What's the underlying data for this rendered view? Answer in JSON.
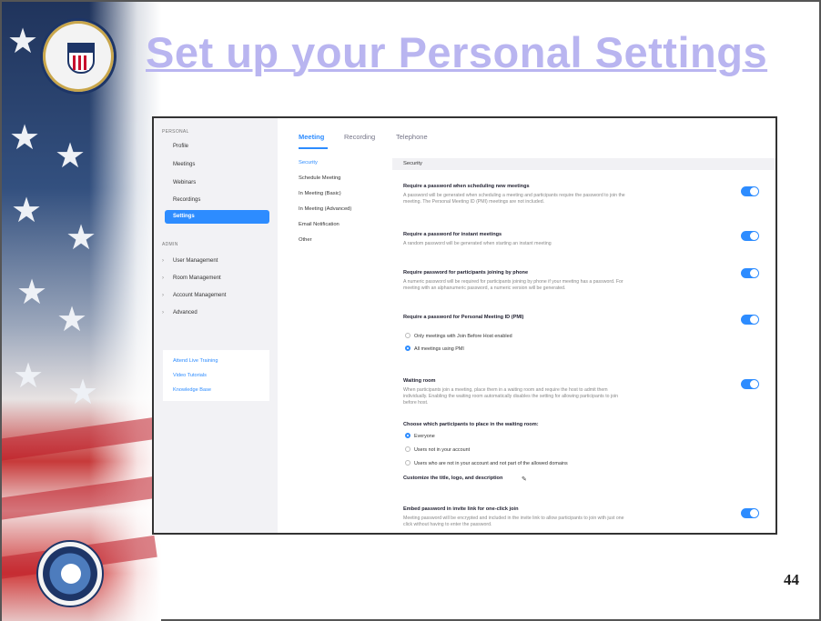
{
  "slide": {
    "title": "Set up your Personal Settings",
    "page_number": "44"
  },
  "sidebar": {
    "personal_heading": "PERSONAL",
    "personal_items": [
      "Profile",
      "Meetings",
      "Webinars",
      "Recordings",
      "Settings"
    ],
    "active_item": "Settings",
    "admin_heading": "ADMIN",
    "admin_items": [
      "User Management",
      "Room Management",
      "Account Management",
      "Advanced"
    ],
    "help_links": [
      "Attend Live Training",
      "Video Tutorials",
      "Knowledge Base"
    ]
  },
  "tabs": [
    "Meeting",
    "Recording",
    "Telephone"
  ],
  "active_tab": "Meeting",
  "subnav": [
    "Security",
    "Schedule Meeting",
    "In Meeting (Basic)",
    "In Meeting (Advanced)",
    "Email Notification",
    "Other"
  ],
  "active_subnav": "Security",
  "section_title": "Security",
  "settings": [
    {
      "title": "Require a password when scheduling new meetings",
      "desc1": "A password will be generated when scheduling a meeting and participants require the password to join the",
      "desc2": "meeting. The Personal Meeting ID (PMI) meetings are not included.",
      "enabled": true
    },
    {
      "title": "Require a password for instant meetings",
      "desc1": "A random password will be generated when starting an instant meeting",
      "enabled": true
    },
    {
      "title": "Require password for participants joining by phone",
      "desc1": "A numeric password will be required for participants joining by phone if your meeting has a password. For",
      "desc2": "meeting with an alphanumeric password, a numeric version will be generated.",
      "enabled": true
    },
    {
      "title": "Require a password for Personal Meeting ID (PMI)",
      "enabled": true,
      "options": [
        "Only meetings with Join Before Host enabled",
        "All meetings using PMI"
      ],
      "selected_option": "All meetings using PMI"
    },
    {
      "title": "Waiting room",
      "desc1": "When participants join a meeting, place them in a waiting room and require the host to admit them",
      "desc2": "individually. Enabling the waiting room automatically disables the setting for allowing participants to join",
      "desc3": "before host.",
      "enabled": true
    },
    {
      "title": "Embed password in invite link for one-click join",
      "desc1": "Meeting password will be encrypted and included in the invite link to allow participants to join with just one",
      "desc2": "click without having to enter the password.",
      "enabled": true
    }
  ],
  "waiting_room": {
    "choose_label": "Choose which participants to place in the waiting room:",
    "options": [
      "Everyone",
      "Users not in your account",
      "Users who are not in your account and not part of the allowed domains"
    ],
    "selected_option": "Everyone",
    "customize_label": "Customize the title, logo, and description"
  }
}
